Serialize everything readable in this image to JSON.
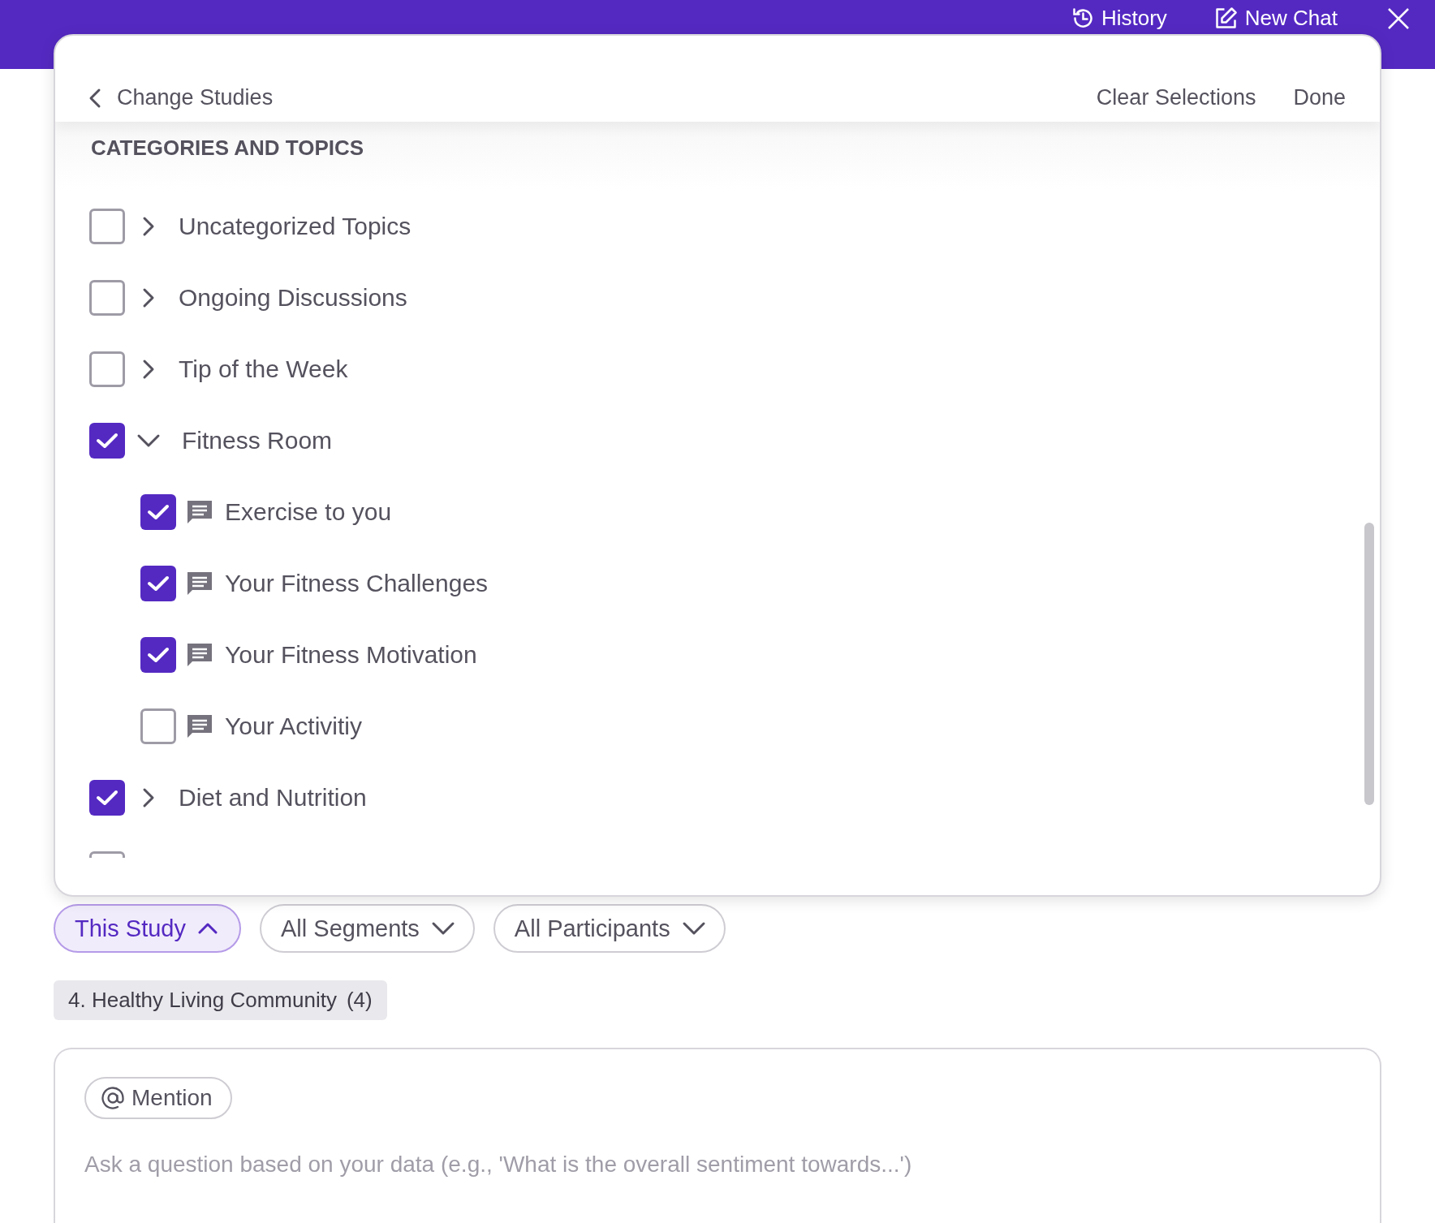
{
  "header": {
    "actions": [
      {
        "kind": "history",
        "label": "History"
      },
      {
        "kind": "new_chat",
        "label": "New Chat"
      }
    ]
  },
  "panel": {
    "back_label": "Change Studies",
    "actions": [
      "Clear Selections",
      "Done"
    ],
    "section_title": "CATEGORIES AND TOPICS",
    "items": [
      {
        "label": "Uncategorized Topics",
        "checked": false,
        "expanded": false
      },
      {
        "label": "Ongoing Discussions",
        "checked": false,
        "expanded": false
      },
      {
        "label": "Tip of the Week",
        "checked": false,
        "expanded": false
      },
      {
        "label": "Fitness Room",
        "checked": true,
        "expanded": true,
        "children": [
          {
            "label": "Exercise to you",
            "checked": true
          },
          {
            "label": "Your Fitness Challenges",
            "checked": true
          },
          {
            "label": "Your Fitness Motivation",
            "checked": true
          },
          {
            "label": "Your Activitiy",
            "checked": false
          }
        ]
      },
      {
        "label": "Diet and Nutrition",
        "checked": true,
        "expanded": false
      }
    ],
    "cut_off_item": {
      "checked": false
    }
  },
  "filters": [
    {
      "label": "This Study",
      "selected": true
    },
    {
      "label": "All Segments",
      "selected": false
    },
    {
      "label": "All Participants",
      "selected": false
    }
  ],
  "study_tag": {
    "name": "4. Healthy Living Community",
    "count": "(4)"
  },
  "composer": {
    "mention_label": "Mention",
    "placeholder": "Ask a question based on your data (e.g., 'What is the overall sentiment towards...')"
  }
}
